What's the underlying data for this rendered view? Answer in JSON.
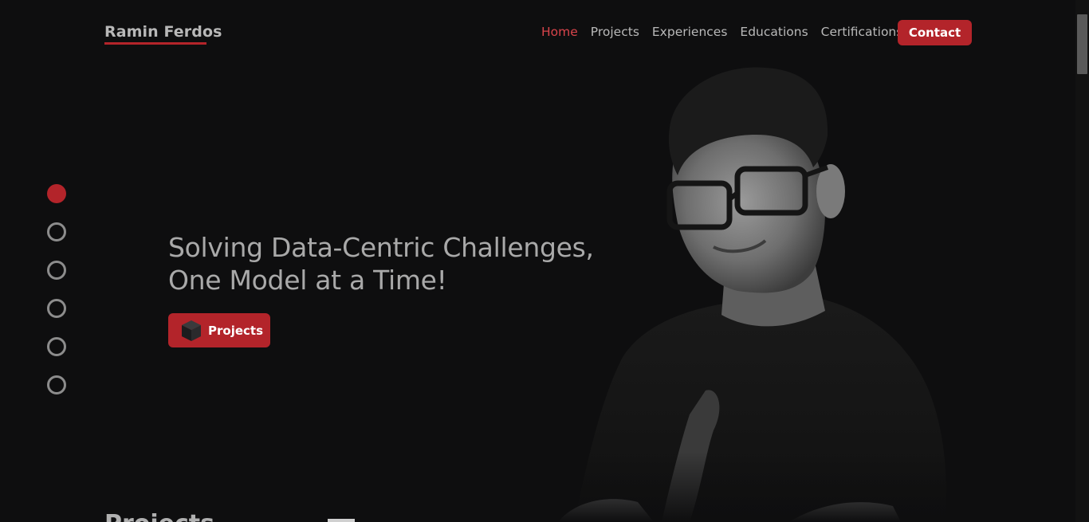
{
  "header": {
    "brand": "Ramin Ferdos",
    "nav": [
      {
        "label": "Home",
        "active": true
      },
      {
        "label": "Projects",
        "active": false
      },
      {
        "label": "Experiences",
        "active": false
      },
      {
        "label": "Educations",
        "active": false
      },
      {
        "label": "Certifications",
        "active": false
      }
    ],
    "contact_label": "Contact"
  },
  "side_nav": {
    "count": 6,
    "active_index": 0
  },
  "hero": {
    "title_line1": "Solving Data-Centric Challenges,",
    "title_line2": "One Model at a Time!",
    "button_label": "Projects",
    "button_icon": "cube-icon"
  },
  "next_section": {
    "title_peek": "Projects"
  },
  "colors": {
    "background": "#0e0e0f",
    "accent": "#b3242a",
    "active_nav": "#d9444b",
    "text": "#a9a9a9"
  }
}
